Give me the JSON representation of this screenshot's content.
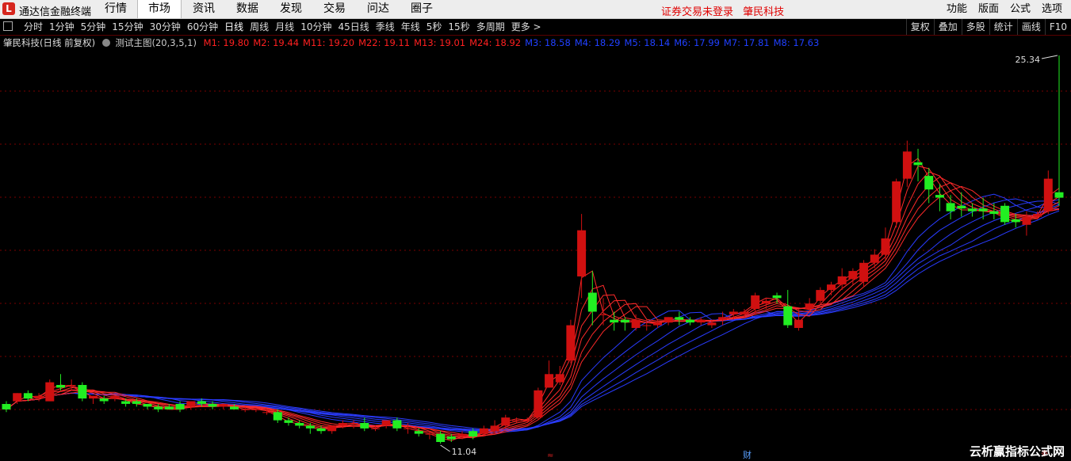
{
  "app": {
    "logo": "L",
    "title": "通达信金融终端"
  },
  "top_menu": [
    "行情",
    "市场",
    "资讯",
    "数据",
    "发现",
    "交易",
    "问达",
    "圈子"
  ],
  "top_menu_active": 1,
  "warning": {
    "text": "证券交易未登录",
    "stock": "肇民科技"
  },
  "right_menu": [
    "功能",
    "版面",
    "公式",
    "选项"
  ],
  "period_tabs": [
    "分时",
    "1分钟",
    "5分钟",
    "15分钟",
    "30分钟",
    "60分钟",
    "日线",
    "周线",
    "月线",
    "10分钟",
    "45日线",
    "季线",
    "年线",
    "5秒",
    "15秒",
    "多周期",
    "更多 >"
  ],
  "period_active": 6,
  "right_tools": [
    "复权",
    "叠加",
    "多股",
    "统计",
    "画线",
    "F10"
  ],
  "indicator": {
    "stock_label": "肇民科技(日线 前复权)",
    "formula": "测试主图(20,3,5,1)",
    "red_values": [
      "M1: 19.80",
      "M2: 19.44",
      "M11: 19.20",
      "M22: 19.11",
      "M13: 19.01",
      "M24: 18.92"
    ],
    "blue_values": [
      "M3: 18.58",
      "M4: 18.29",
      "M5: 18.14",
      "M6: 17.99",
      "M7: 17.81",
      "M8: 17.63"
    ]
  },
  "colors": {
    "up": "#d01010",
    "down": "#22ee22",
    "red_ma": "#ff2a2a",
    "blue_ma": "#2a3cff",
    "grid": "#7a0000"
  },
  "chart_data": {
    "type": "candlestick",
    "price_high_label": "25.34",
    "price_low_label": "11.04",
    "candles": [
      [
        12.5,
        12.6,
        12.3,
        12.2
      ],
      [
        12.6,
        12.9,
        12.9,
        12.5
      ],
      [
        12.9,
        13.0,
        12.7,
        12.6
      ],
      [
        12.7,
        12.9,
        12.8,
        12.6
      ],
      [
        12.6,
        13.4,
        13.3,
        12.6
      ],
      [
        13.2,
        13.6,
        13.1,
        13.0
      ],
      [
        13.2,
        13.4,
        13.2,
        13.0
      ],
      [
        13.2,
        13.3,
        12.7,
        12.6
      ],
      [
        12.7,
        12.8,
        12.8,
        12.5
      ],
      [
        12.7,
        12.8,
        12.6,
        12.5
      ],
      [
        12.7,
        12.8,
        12.8,
        12.6
      ],
      [
        12.6,
        12.7,
        12.5,
        12.4
      ],
      [
        12.6,
        12.7,
        12.5,
        12.4
      ],
      [
        12.5,
        12.5,
        12.4,
        12.3
      ],
      [
        12.4,
        12.5,
        12.3,
        12.2
      ],
      [
        12.4,
        12.5,
        12.3,
        12.3
      ],
      [
        12.5,
        12.6,
        12.3,
        12.2
      ],
      [
        12.4,
        12.6,
        12.6,
        12.3
      ],
      [
        12.6,
        12.7,
        12.5,
        12.4
      ],
      [
        12.5,
        12.6,
        12.4,
        12.3
      ],
      [
        12.4,
        12.5,
        12.5,
        12.3
      ],
      [
        12.4,
        12.5,
        12.3,
        12.3
      ],
      [
        12.3,
        12.4,
        12.3,
        12.2
      ],
      [
        12.3,
        12.3,
        12.3,
        12.2
      ],
      [
        12.2,
        12.3,
        12.2,
        12.1
      ],
      [
        12.2,
        12.3,
        11.9,
        11.8
      ],
      [
        11.9,
        12.0,
        11.8,
        11.7
      ],
      [
        11.8,
        11.9,
        11.7,
        11.6
      ],
      [
        11.7,
        11.8,
        11.6,
        11.4
      ],
      [
        11.6,
        11.7,
        11.5,
        11.4
      ],
      [
        11.5,
        11.7,
        11.7,
        11.4
      ],
      [
        11.7,
        11.9,
        11.8,
        11.6
      ],
      [
        11.8,
        11.9,
        11.8,
        11.6
      ],
      [
        11.8,
        12.0,
        11.6,
        11.5
      ],
      [
        11.6,
        11.7,
        11.6,
        11.5
      ],
      [
        11.7,
        11.9,
        11.9,
        11.6
      ],
      [
        11.9,
        12.0,
        11.6,
        11.5
      ],
      [
        11.6,
        11.8,
        11.6,
        11.4
      ],
      [
        11.5,
        11.6,
        11.4,
        11.3
      ],
      [
        11.4,
        11.5,
        11.4,
        11.2
      ],
      [
        11.4,
        11.5,
        11.1,
        11.04
      ],
      [
        11.3,
        11.4,
        11.2,
        11.1
      ],
      [
        11.3,
        11.5,
        11.4,
        11.2
      ],
      [
        11.5,
        11.6,
        11.3,
        11.2
      ],
      [
        11.4,
        11.7,
        11.6,
        11.3
      ],
      [
        11.5,
        11.9,
        11.7,
        11.4
      ],
      [
        11.7,
        12.1,
        12.0,
        11.6
      ],
      [
        11.9,
        12.0,
        11.9,
        11.8
      ],
      [
        11.9,
        12.0,
        11.9,
        11.8
      ],
      [
        12.0,
        13.1,
        13.0,
        11.9
      ],
      [
        13.1,
        14.1,
        13.6,
        13.1
      ],
      [
        13.3,
        13.9,
        13.6,
        13.2
      ],
      [
        14.1,
        15.6,
        15.4,
        14.0
      ],
      [
        17.2,
        19.5,
        18.9,
        16.4
      ],
      [
        16.6,
        17.4,
        15.9,
        15.4
      ],
      [
        15.8,
        16.4,
        15.8,
        15.4
      ],
      [
        15.6,
        15.9,
        15.5,
        15.2
      ],
      [
        15.6,
        15.7,
        15.5,
        15.2
      ],
      [
        15.3,
        15.8,
        15.6,
        15.2
      ],
      [
        15.4,
        15.6,
        15.4,
        15.2
      ],
      [
        15.4,
        15.6,
        15.5,
        15.3
      ],
      [
        15.5,
        15.7,
        15.7,
        15.4
      ],
      [
        15.7,
        15.9,
        15.6,
        15.4
      ],
      [
        15.6,
        15.7,
        15.5,
        15.4
      ],
      [
        15.5,
        15.7,
        15.6,
        15.4
      ],
      [
        15.4,
        15.6,
        15.5,
        15.3
      ],
      [
        15.6,
        15.9,
        15.7,
        15.4
      ],
      [
        15.8,
        16.0,
        15.9,
        15.6
      ],
      [
        15.8,
        16.0,
        15.9,
        15.7
      ],
      [
        16.0,
        16.6,
        16.5,
        15.8
      ],
      [
        16.2,
        16.4,
        16.3,
        16.0
      ],
      [
        16.5,
        16.6,
        16.4,
        16.2
      ],
      [
        16.1,
        16.7,
        15.4,
        15.3
      ],
      [
        15.3,
        16.0,
        15.6,
        15.2
      ],
      [
        16.0,
        16.4,
        16.2,
        15.9
      ],
      [
        16.3,
        16.8,
        16.7,
        16.2
      ],
      [
        16.7,
        17.0,
        16.9,
        16.5
      ],
      [
        16.9,
        17.5,
        17.2,
        16.7
      ],
      [
        17.1,
        17.5,
        17.4,
        16.9
      ],
      [
        17.0,
        17.8,
        17.7,
        16.8
      ],
      [
        17.7,
        18.2,
        18.0,
        17.5
      ],
      [
        18.0,
        19.0,
        18.6,
        17.8
      ],
      [
        19.2,
        20.8,
        20.7,
        19.0
      ],
      [
        20.8,
        22.2,
        21.8,
        20.5
      ],
      [
        21.4,
        21.9,
        21.3,
        20.7
      ],
      [
        20.9,
        21.2,
        20.4,
        19.9
      ],
      [
        20.2,
        20.6,
        20.1,
        19.6
      ],
      [
        19.9,
        20.2,
        19.6,
        19.3
      ],
      [
        19.8,
        20.3,
        19.7,
        19.4
      ],
      [
        19.7,
        19.9,
        19.6,
        19.4
      ],
      [
        19.7,
        20.1,
        19.6,
        19.3
      ],
      [
        19.6,
        19.9,
        19.5,
        19.3
      ],
      [
        19.8,
        19.9,
        19.2,
        19.1
      ],
      [
        19.3,
        19.5,
        19.2,
        19.0
      ],
      [
        19.1,
        19.6,
        19.4,
        18.7
      ],
      [
        19.4,
        19.6,
        19.5,
        19.3
      ],
      [
        19.6,
        21.1,
        20.8,
        19.5
      ],
      [
        20.3,
        25.34,
        20.1,
        19.8
      ]
    ]
  },
  "misc": {
    "finance_marker": "财",
    "star_marker": "※",
    "arrow_marker": "≈",
    "watermark": "云析赢指标公式网"
  }
}
